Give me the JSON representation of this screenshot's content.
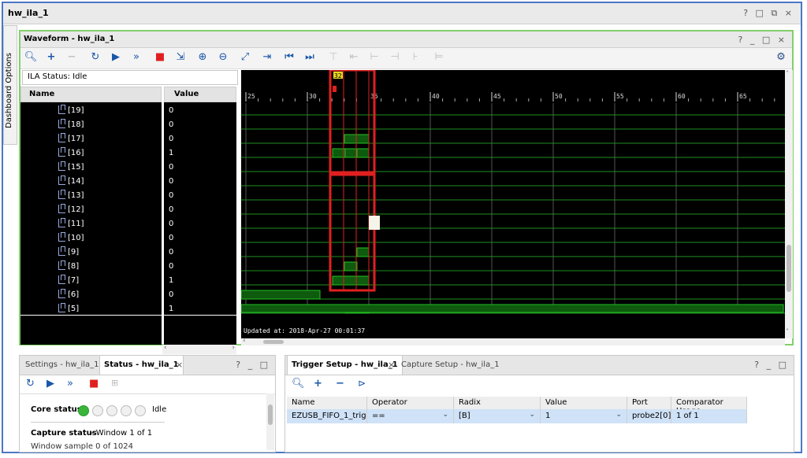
{
  "window": {
    "title": "hw_ila_1",
    "controls": "? □ ⧉ ×"
  },
  "sidebar": {
    "dashboard_tab": "Dashboard Options"
  },
  "waveform_panel": {
    "title": "Waveform - hw_ila_1",
    "controls": "? _ □ ×",
    "ila_status": "ILA Status: Idle",
    "name_header": "Name",
    "value_header": "Value",
    "signals": [
      {
        "name": "[19]",
        "value": "0"
      },
      {
        "name": "[18]",
        "value": "0"
      },
      {
        "name": "[17]",
        "value": "0"
      },
      {
        "name": "[16]",
        "value": "1"
      },
      {
        "name": "[15]",
        "value": "0"
      },
      {
        "name": "[14]",
        "value": "0"
      },
      {
        "name": "[13]",
        "value": "0"
      },
      {
        "name": "[12]",
        "value": "0"
      },
      {
        "name": "[11]",
        "value": "0"
      },
      {
        "name": "[10]",
        "value": "0"
      },
      {
        "name": "[9]",
        "value": "0"
      },
      {
        "name": "[8]",
        "value": "0"
      },
      {
        "name": "[7]",
        "value": "1"
      },
      {
        "name": "[6]",
        "value": "0"
      },
      {
        "name": "[5]",
        "value": "1"
      }
    ],
    "timeline_ticks": [
      "25",
      "30",
      "35",
      "40",
      "45",
      "50",
      "55",
      "60",
      "65"
    ],
    "marker_label": "32",
    "updated_text": "Updated at: 2018-Apr-27 00:01:37",
    "colors": {
      "bg": "#000000",
      "grid": "#1f8f1f",
      "trace": "#22c222",
      "marker": "#e02020",
      "highlight": "#e02020"
    }
  },
  "settings_panel": {
    "tab_settings": "Settings - hw_ila_1",
    "tab_status": "Status - hw_ila_1",
    "controls": "? _ □",
    "core_status_label": "Core status",
    "core_status_value": "Idle",
    "capture_status_label": "Capture status",
    "capture_status_value": "- Window 1 of 1",
    "window_sample": "Window sample 0 of 1024"
  },
  "trigger_panel": {
    "tab_trigger": "Trigger Setup - hw_ila_1",
    "tab_capture": "Capture Setup - hw_ila_1",
    "controls": "? _ □",
    "columns": [
      "Name",
      "Operator",
      "Radix",
      "Value",
      "Port",
      "Comparator Usage"
    ],
    "row": {
      "name": "EZUSB_FIFO_1_trig",
      "operator": "==",
      "radix": "[B]",
      "value": "1",
      "port": "probe2[0]",
      "comparator_usage": "1 of 1"
    }
  }
}
